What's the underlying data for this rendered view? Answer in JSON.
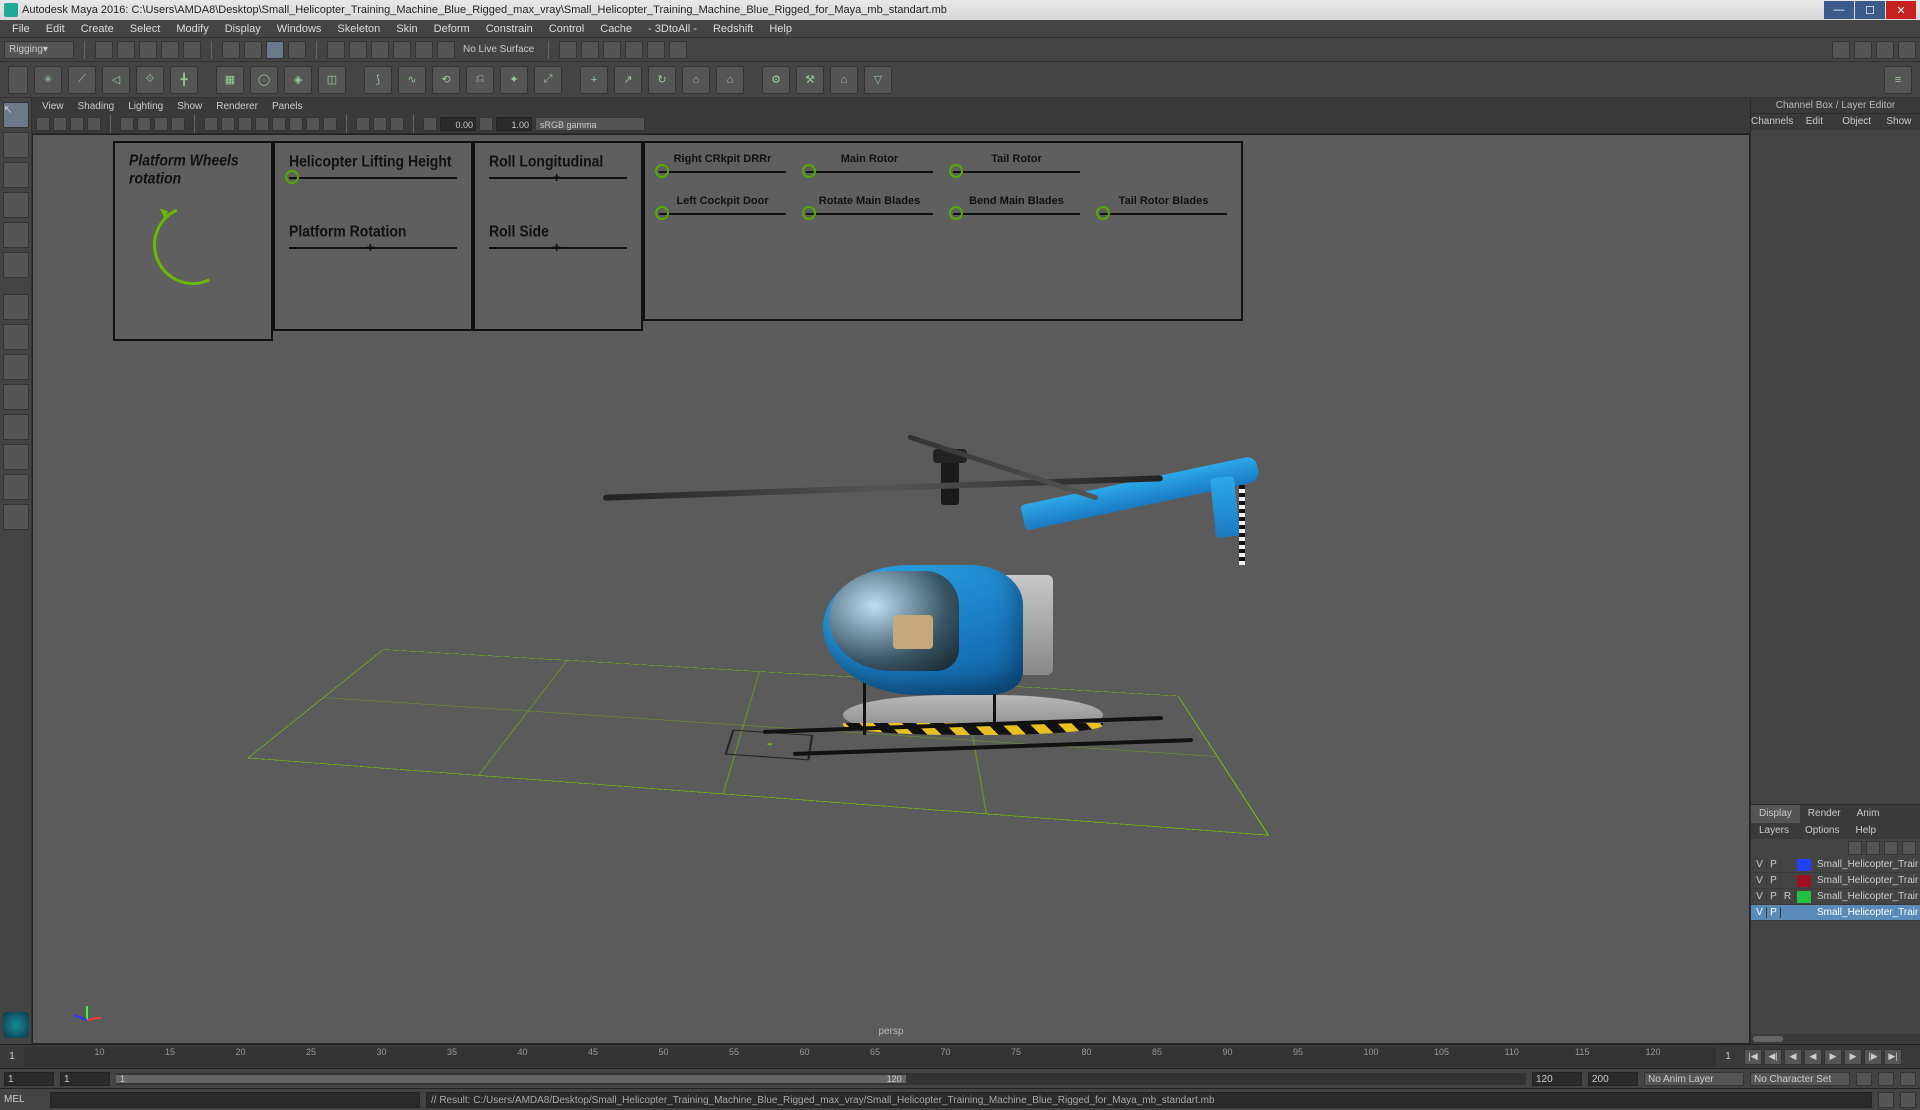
{
  "title": "Autodesk Maya 2016: C:\\Users\\AMDA8\\Desktop\\Small_Helicopter_Training_Machine_Blue_Rigged_max_vray\\Small_Helicopter_Training_Machine_Blue_Rigged_for_Maya_mb_standart.mb",
  "menubar": [
    "File",
    "Edit",
    "Create",
    "Select",
    "Modify",
    "Display",
    "Windows",
    "Skeleton",
    "Skin",
    "Deform",
    "Constrain",
    "Control",
    "Cache",
    "- 3DtoAll -",
    "Redshift",
    "Help"
  ],
  "toolbox_mode": "Rigging",
  "no_live_surface": "No Live Surface",
  "viewport_menus": [
    "View",
    "Shading",
    "Lighting",
    "Show",
    "Renderer",
    "Panels"
  ],
  "vp_num1": "0.00",
  "vp_num2": "1.00",
  "vp_colorspace": "sRGB gamma",
  "persp_label": "persp",
  "controls": {
    "box1_title": "Platform Wheels rotation",
    "box2_a": "Helicopter Lifting Height",
    "box2_b": "Platform Rotation",
    "box3_a": "Roll Longitudinal",
    "box3_b": "Roll Side",
    "box4": [
      "Right CRkpit DRRr",
      "Main Rotor",
      "Tail Rotor",
      "Left Cockpit Door",
      "Rotate Main Blades",
      "Bend Main Blades",
      "Tail Rotor Blades"
    ]
  },
  "right_panel": {
    "title": "Channel Box / Layer Editor",
    "tabs": [
      "Channels",
      "Edit",
      "Object",
      "Show"
    ],
    "lower_tabs": [
      "Display",
      "Render",
      "Anim"
    ],
    "sub_tabs": [
      "Layers",
      "Options",
      "Help"
    ],
    "layers": [
      {
        "v": "V",
        "p": "P",
        "r": "",
        "color": "#2040ff",
        "name": "Small_Helicopter_Training_M",
        "sel": false
      },
      {
        "v": "V",
        "p": "P",
        "r": "",
        "color": "#a01020",
        "name": "Small_Helicopter_Train",
        "sel": false
      },
      {
        "v": "V",
        "p": "P",
        "r": "R",
        "color": "#20c040",
        "name": "Small_Helicopter_Training_M",
        "sel": false
      },
      {
        "v": "V",
        "p": "P",
        "r": "",
        "color": "#5a8ab8",
        "name": "Small_Helicopter_Training_M",
        "sel": true
      }
    ]
  },
  "timeline": {
    "start_vis": "1",
    "end_vis": "1",
    "ticks": [
      "10",
      "15",
      "20",
      "25",
      "30",
      "35",
      "40",
      "45",
      "50",
      "55",
      "60",
      "65",
      "70",
      "75",
      "80",
      "85",
      "90",
      "95",
      "100",
      "105",
      "110",
      "115",
      "120"
    ]
  },
  "range": {
    "start": "1",
    "start2": "1",
    "cur": "1",
    "end": "120",
    "end2": "120",
    "total": "200",
    "anim_layer": "No Anim Layer",
    "char_set": "No Character Set"
  },
  "cmd": {
    "label": "MEL",
    "output": "// Result: C:/Users/AMDA8/Desktop/Small_Helicopter_Training_Machine_Blue_Rigged_max_vray/Small_Helicopter_Training_Machine_Blue_Rigged_for_Maya_mb_standart.mb"
  }
}
